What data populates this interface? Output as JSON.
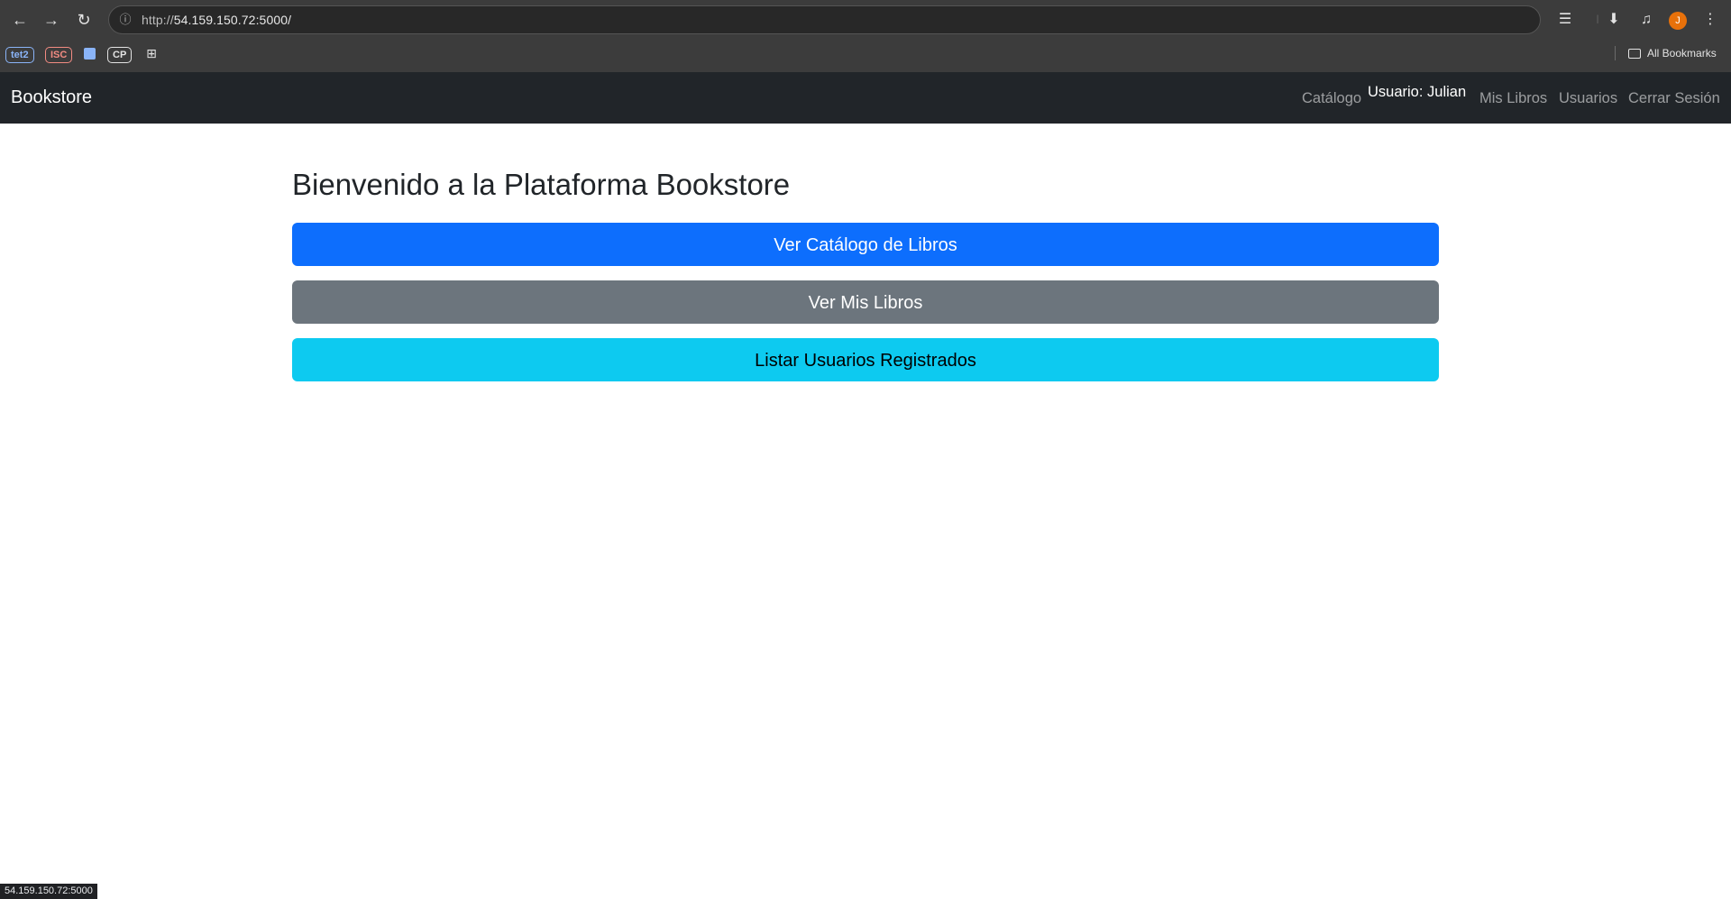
{
  "browser": {
    "url": "http://54.159.150.72:5000/",
    "url_scheme": "http://",
    "url_host": "54.159.150.72:5000/",
    "back_icon": "back-arrow-icon",
    "forward_icon": "forward-arrow-icon",
    "reload_icon": "reload-icon",
    "site_info_icon": "site-info-icon",
    "profile_initial": "J",
    "profile_color": "#e8710a",
    "bookmarks": [
      {
        "label": "tet2",
        "color": "#8ab4f8"
      },
      {
        "label": "ISC",
        "color": "#f28b82"
      },
      {
        "label": "",
        "color": "#8ab4f8"
      },
      {
        "label": "CP",
        "color": "#e3e3e3"
      }
    ],
    "all_bookmarks_label": "All Bookmarks",
    "status_url": "54.159.150.72:5000"
  },
  "navbar": {
    "brand": "Bookstore",
    "catalog": "Catálogo",
    "user": "Usuario: Julian",
    "my_books": "Mis Libros",
    "users": "Usuarios",
    "logout": "Cerrar Sesión",
    "background": "#212529"
  },
  "main": {
    "title": "Bienvenido a la Plataforma Bookstore",
    "buttons": [
      {
        "label": "Ver Catálogo de Libros",
        "color": "#0d6efd",
        "text_color": "#ffffff"
      },
      {
        "label": "Ver Mis Libros",
        "color": "#6c757d",
        "text_color": "#ffffff"
      },
      {
        "label": "Listar Usuarios Registrados",
        "color": "#0dcaf0",
        "text_color": "#000000"
      }
    ]
  }
}
